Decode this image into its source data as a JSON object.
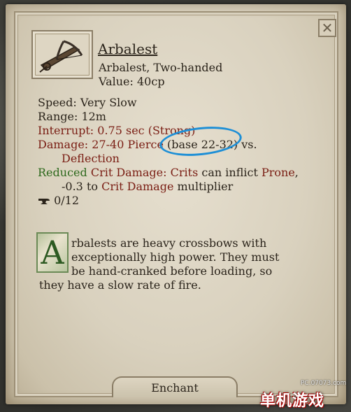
{
  "tooltip": {
    "close_glyph": "✕",
    "item_name": "Arbalest",
    "item_type": "Arbalest, Two-handed",
    "value": "Value: 40cp",
    "icon": "crossbow-icon"
  },
  "stats": {
    "speed": "Speed: Very Slow",
    "range": "Range: 12m",
    "interrupt": "Interrupt: 0.75 sec (Strong)",
    "damage_label": "Damage: 27-40",
    "damage_type": "Pierce",
    "damage_base": "(base 22-32)",
    "damage_vs": "vs.",
    "defense": "Deflection",
    "mod_reduced": "Reduced",
    "mod_crit_damage": "Crit Damage:",
    "mod_crits": "Crits",
    "mod_can_inflict": "can inflict",
    "mod_prone": "Prone",
    "mod_comma": ",",
    "mod_line2_value": "-0.3 to",
    "mod_line2_crit": "Crit Damage",
    "mod_line2_multiplier": "multiplier",
    "enchant_icon": "anvil-icon",
    "enchant_capacity": "0/12"
  },
  "description": {
    "dropcap": "A",
    "line1": "rbalests are heavy crossbows with",
    "line2": "exceptionally high power. They must",
    "line3": "be hand-cranked before loading, so",
    "line4": "they have a slow rate of fire."
  },
  "buttons": {
    "enchant": "Enchant"
  },
  "watermark": {
    "url": "PC.07073.com",
    "logo": "单机游戏"
  },
  "colors": {
    "parchment": "#d9d1be",
    "text": "#2b241b",
    "keyword_red": "#7a1e14",
    "keyword_green": "#2f6a1e",
    "annotation_blue": "#1e8fd6"
  }
}
